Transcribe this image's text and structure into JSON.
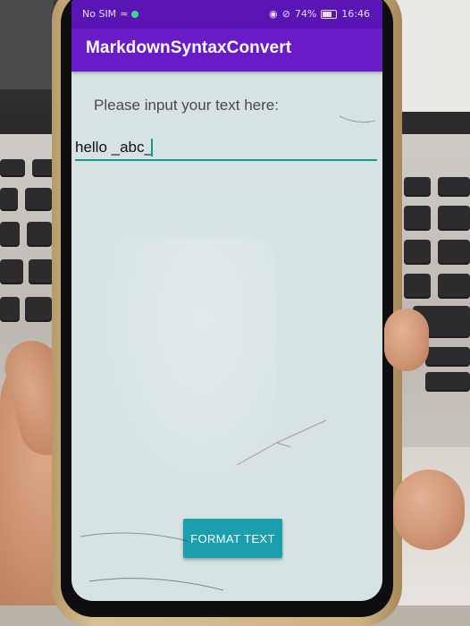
{
  "status_bar": {
    "carrier": "No SIM",
    "battery": "74%",
    "time": "16:46"
  },
  "app": {
    "title": "MarkdownSyntaxConvert"
  },
  "form": {
    "prompt": "Please input your text here:",
    "input_value": "hello _abc_",
    "button_label": "FORMAT TEXT"
  },
  "colors": {
    "status_bar": "#5b14b4",
    "app_bar": "#6a1bc8",
    "accent": "#149a8a",
    "button": "#1a9fae",
    "screen_bg": "#d7e3e3"
  }
}
